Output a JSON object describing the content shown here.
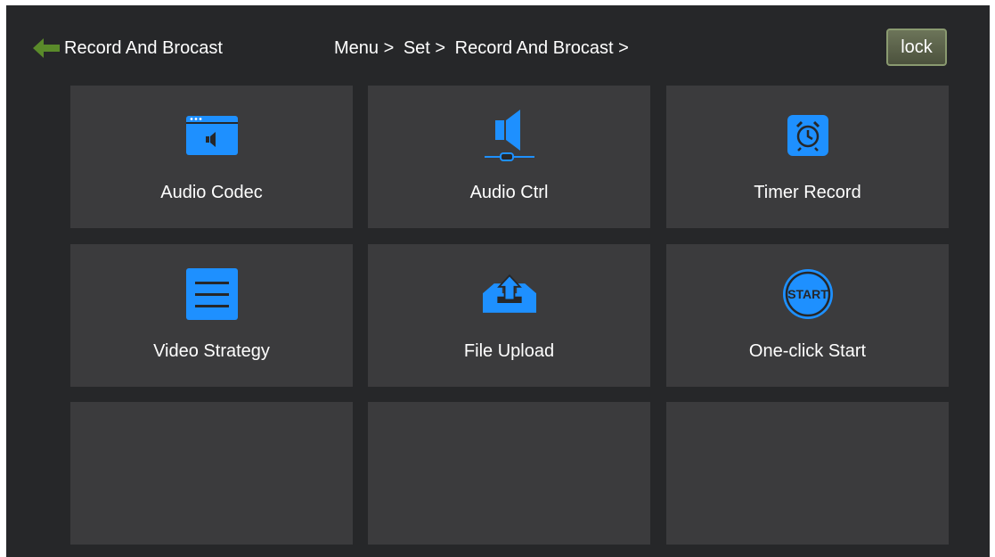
{
  "header": {
    "back_icon": "arrow-left-icon",
    "title": "Record And Brocast",
    "breadcrumb": [
      "Menu >",
      "Set >",
      "Record And Brocast >"
    ],
    "lock_label": "lock"
  },
  "tiles": [
    {
      "label": "Audio Codec",
      "icon": "audio-codec-icon"
    },
    {
      "label": "Audio Ctrl",
      "icon": "speaker-slider-icon"
    },
    {
      "label": "Timer Record",
      "icon": "alarm-clock-icon"
    },
    {
      "label": "Video Strategy",
      "icon": "list-document-icon"
    },
    {
      "label": "File Upload",
      "icon": "upload-tray-icon"
    },
    {
      "label": "One-click Start",
      "icon": "start-icon"
    },
    {
      "label": "",
      "icon": ""
    },
    {
      "label": "",
      "icon": ""
    },
    {
      "label": "",
      "icon": ""
    }
  ],
  "colors": {
    "background": "#262729",
    "tile": "#3b3b3d",
    "accent": "#1e90ff",
    "back_arrow": "#5a8a2a",
    "lock_button": "#5c6349"
  }
}
